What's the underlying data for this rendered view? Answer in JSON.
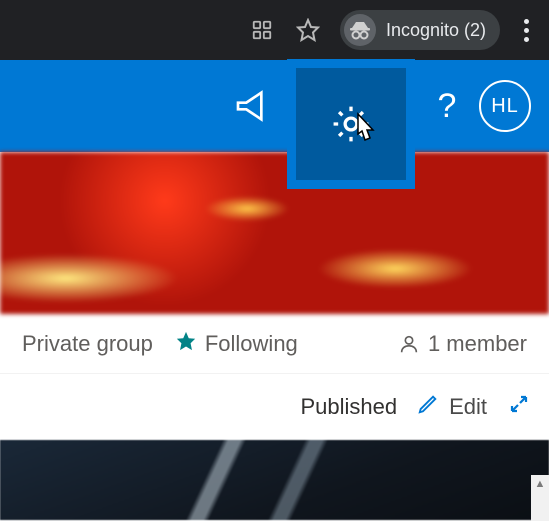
{
  "browser": {
    "incognito_label": "Incognito (2)"
  },
  "header": {
    "avatar_initials": "HL",
    "help_label": "?"
  },
  "info": {
    "group_type": "Private group",
    "following_label": "Following",
    "members_label": "1 member"
  },
  "actions": {
    "status_label": "Published",
    "edit_label": "Edit"
  }
}
